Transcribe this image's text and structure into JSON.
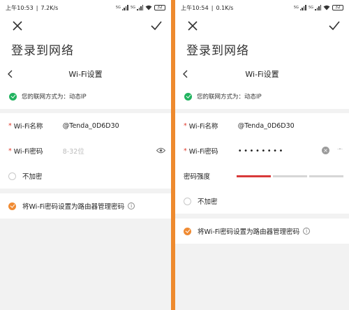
{
  "left": {
    "status": {
      "time": "上午10:53",
      "speed": "7.2K/s",
      "battery": "32"
    },
    "title": "登录到网络",
    "subtitle": "Wi-Fi设置",
    "connection_text": "您的联网方式为：动态IP",
    "wifi_name_label": "Wi-Fi名称",
    "wifi_name_value": "@Tenda_0D6D30",
    "wifi_password_label": "Wi-Fi密码",
    "wifi_password_placeholder": "8-32位",
    "no_encrypt_label": "不加密",
    "use_router_pw_label": "将Wi-Fi密码设置为路由器管理密码"
  },
  "right": {
    "status": {
      "time": "上午10:54",
      "speed": "0.1K/s",
      "battery": "32"
    },
    "title": "登录到网络",
    "subtitle": "Wi-Fi设置",
    "connection_text": "您的联网方式为：动态IP",
    "wifi_name_label": "Wi-Fi名称",
    "wifi_name_value": "@Tenda_0D6D30",
    "wifi_password_label": "Wi-Fi密码",
    "wifi_password_value": "••••••••",
    "strength_label": "密码强度",
    "strength_level": 1,
    "strength_total": 3,
    "no_encrypt_label": "不加密",
    "use_router_pw_label": "将Wi-Fi密码设置为路由器管理密码"
  },
  "status_sep": "|",
  "signal_label": "5G",
  "required_mark": "*",
  "info_symbol": "i",
  "colors": {
    "accent": "#f08b33",
    "success": "#21b35f",
    "required": "#e0392b",
    "weak": "#d83a3a"
  },
  "icons": [
    "close-icon",
    "check-icon",
    "back-icon",
    "eye-icon",
    "clear-icon",
    "eye-off-icon",
    "info-icon",
    "wifi-icon",
    "battery-icon"
  ]
}
